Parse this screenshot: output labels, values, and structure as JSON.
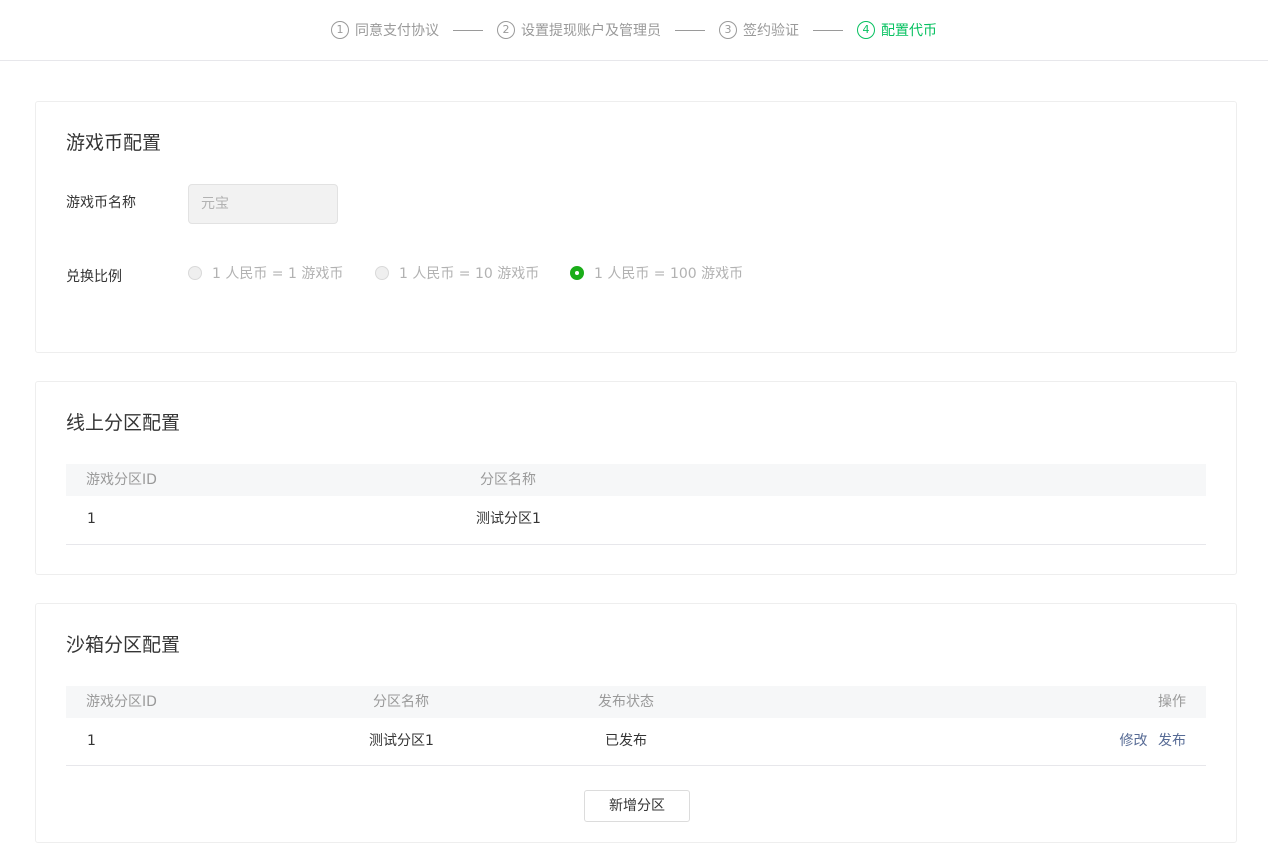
{
  "stepper": {
    "steps": [
      {
        "num": "1",
        "label": "同意支付协议",
        "active": false
      },
      {
        "num": "2",
        "label": "设置提现账户及管理员",
        "active": false
      },
      {
        "num": "3",
        "label": "签约验证",
        "active": false
      },
      {
        "num": "4",
        "label": "配置代币",
        "active": true
      }
    ]
  },
  "coin_config": {
    "title": "游戏币配置",
    "name_label": "游戏币名称",
    "name_value": "元宝",
    "ratio_label": "兑换比例",
    "ratio_options": [
      {
        "label": "1 人民币 = 1 游戏币",
        "checked": false
      },
      {
        "label": "1 人民币 = 10 游戏币",
        "checked": false
      },
      {
        "label": "1 人民币 = 100 游戏币",
        "checked": true
      }
    ]
  },
  "online_zones": {
    "title": "线上分区配置",
    "columns": [
      "游戏分区ID",
      "分区名称"
    ],
    "rows": [
      [
        "1",
        "测试分区1"
      ]
    ]
  },
  "sandbox_zones": {
    "title": "沙箱分区配置",
    "columns": [
      "游戏分区ID",
      "分区名称",
      "发布状态",
      "操作"
    ],
    "rows": [
      {
        "id": "1",
        "name": "测试分区1",
        "status": "已发布",
        "actions": [
          "修改",
          "发布"
        ]
      }
    ],
    "add_button": "新增分区"
  },
  "colors": {
    "accent": "#07c160",
    "radio_checked": "#1aad19",
    "link": "#576b95"
  }
}
